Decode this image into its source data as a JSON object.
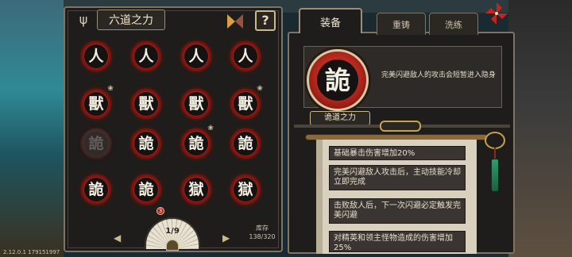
{
  "header": {
    "title": "六道之力"
  },
  "icons": {
    "trident": "trident-icon",
    "sort": "sort-toggle-icon",
    "pinwheel": "red-pinwheel-icon"
  },
  "help_label": "?",
  "grid": {
    "rows": [
      [
        {
          "glyph": "人",
          "dim": false,
          "badge": false
        },
        {
          "glyph": "人",
          "dim": false,
          "badge": false
        },
        {
          "glyph": "人",
          "dim": false,
          "badge": false
        },
        {
          "glyph": "人",
          "dim": false,
          "badge": false
        }
      ],
      [
        {
          "glyph": "獸",
          "dim": false,
          "badge": true
        },
        {
          "glyph": "獸",
          "dim": false,
          "badge": false
        },
        {
          "glyph": "獸",
          "dim": false,
          "badge": false
        },
        {
          "glyph": "獸",
          "dim": false,
          "badge": true
        }
      ],
      [
        {
          "glyph": "詭",
          "dim": true,
          "badge": false
        },
        {
          "glyph": "詭",
          "dim": false,
          "badge": false
        },
        {
          "glyph": "詭",
          "dim": false,
          "badge": true
        },
        {
          "glyph": "詭",
          "dim": false,
          "badge": false
        }
      ],
      [
        {
          "glyph": "詭",
          "dim": false,
          "badge": false
        },
        {
          "glyph": "詭",
          "dim": false,
          "badge": false
        },
        {
          "glyph": "獄",
          "dim": false,
          "badge": false
        },
        {
          "glyph": "獄",
          "dim": false,
          "badge": false
        }
      ]
    ]
  },
  "pager": {
    "page": "1/9",
    "prev": "◀",
    "next": "▶"
  },
  "new_badge": "3",
  "storage": {
    "label": "库存",
    "value": "138/320"
  },
  "tabs": [
    {
      "label": "装备",
      "active": true
    },
    {
      "label": "重铸",
      "active": false
    },
    {
      "label": "洗练",
      "active": false
    }
  ],
  "skill": {
    "glyph": "詭",
    "name": "诡道之力",
    "description": "完美闪避敌人的攻击会短暂进入隐身"
  },
  "entries": [
    "基础暴击伤害增加20%",
    "完美闪避敌人攻击后，主动技能冷却立即完成",
    "击败敌人后，下一次闪避必定触发完美闪避",
    "对精英和领主怪物造成的伤害增加25%"
  ],
  "version": "2.12.0.1 179151997",
  "colors": {
    "token_red": "#b0261c",
    "frame": "#7c7466",
    "gold": "#c9a34a",
    "paper": "#d9d1bd"
  }
}
